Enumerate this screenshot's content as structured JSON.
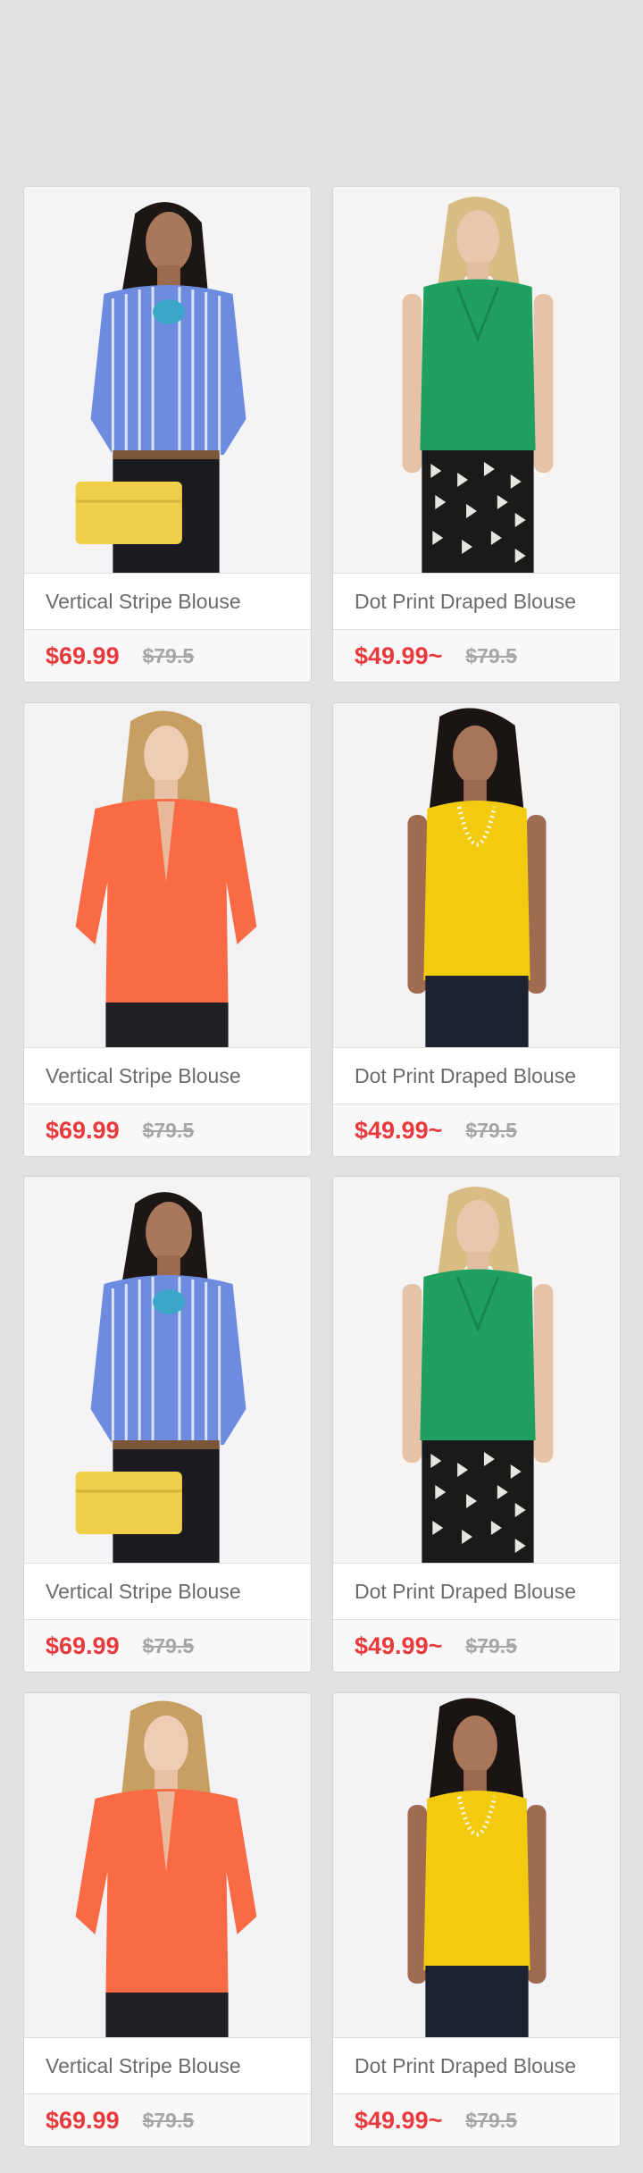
{
  "products": [
    {
      "name": "Vertical Stripe Blouse",
      "price": "$69.99",
      "old_price": "$79.5",
      "image": "stripe-blouse-photo"
    },
    {
      "name": "Dot Print Draped Blouse",
      "price": "$49.99~",
      "old_price": "$79.5",
      "image": "green-blouse-photo"
    },
    {
      "name": "Vertical Stripe Blouse",
      "price": "$69.99",
      "old_price": "$79.5",
      "image": "coral-blouse-photo"
    },
    {
      "name": "Dot Print Draped Blouse",
      "price": "$49.99~",
      "old_price": "$79.5",
      "image": "yellow-blouse-photo"
    },
    {
      "name": "Vertical Stripe Blouse",
      "price": "$69.99",
      "old_price": "$79.5",
      "image": "stripe-blouse-photo"
    },
    {
      "name": "Dot Print Draped Blouse",
      "price": "$49.99~",
      "old_price": "$79.5",
      "image": "green-blouse-photo"
    },
    {
      "name": "Vertical Stripe Blouse",
      "price": "$69.99",
      "old_price": "$79.5",
      "image": "coral-blouse-photo"
    },
    {
      "name": "Dot Print Draped Blouse",
      "price": "$49.99~",
      "old_price": "$79.5",
      "image": "yellow-blouse-photo"
    }
  ],
  "colors": {
    "background": "#e2e2e2",
    "price": "#e8393c",
    "old_price": "#a6a6a6",
    "name": "#6b6b6b"
  }
}
